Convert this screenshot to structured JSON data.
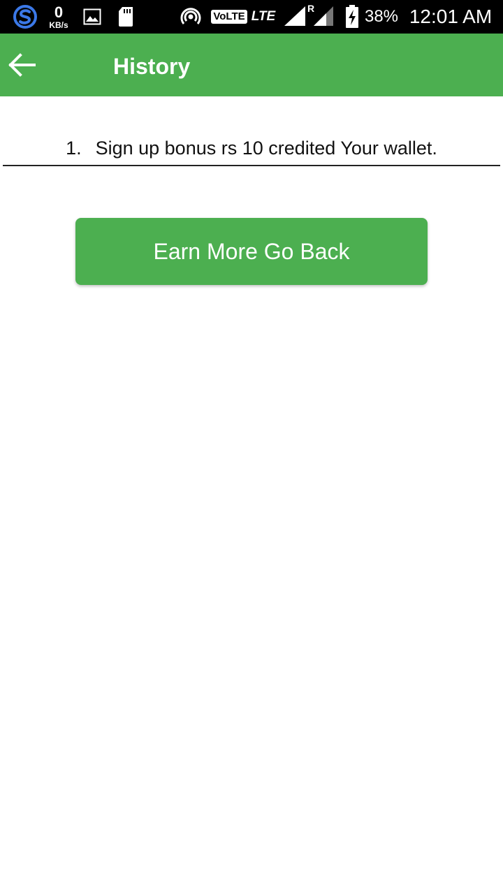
{
  "status_bar": {
    "speed_value": "0",
    "speed_unit": "KB/s",
    "volte": "VoLTE",
    "network": "LTE",
    "roaming": "R",
    "battery_percent": "38%",
    "time": "12:01 AM",
    "icons": [
      "app-s-icon",
      "gallery-icon",
      "sd-card-icon",
      "hotspot-icon",
      "signal-icon",
      "signal-roaming-icon",
      "battery-charging-icon"
    ]
  },
  "app_bar": {
    "title": "History",
    "back_icon": "arrow-left-icon",
    "color": "#4caf50"
  },
  "history": {
    "items": [
      {
        "index": "1.",
        "text": "Sign up bonus rs 10 credited Your wallet."
      }
    ]
  },
  "actions": {
    "earn_more_label": "Earn More Go Back",
    "button_color": "#4caf50"
  }
}
